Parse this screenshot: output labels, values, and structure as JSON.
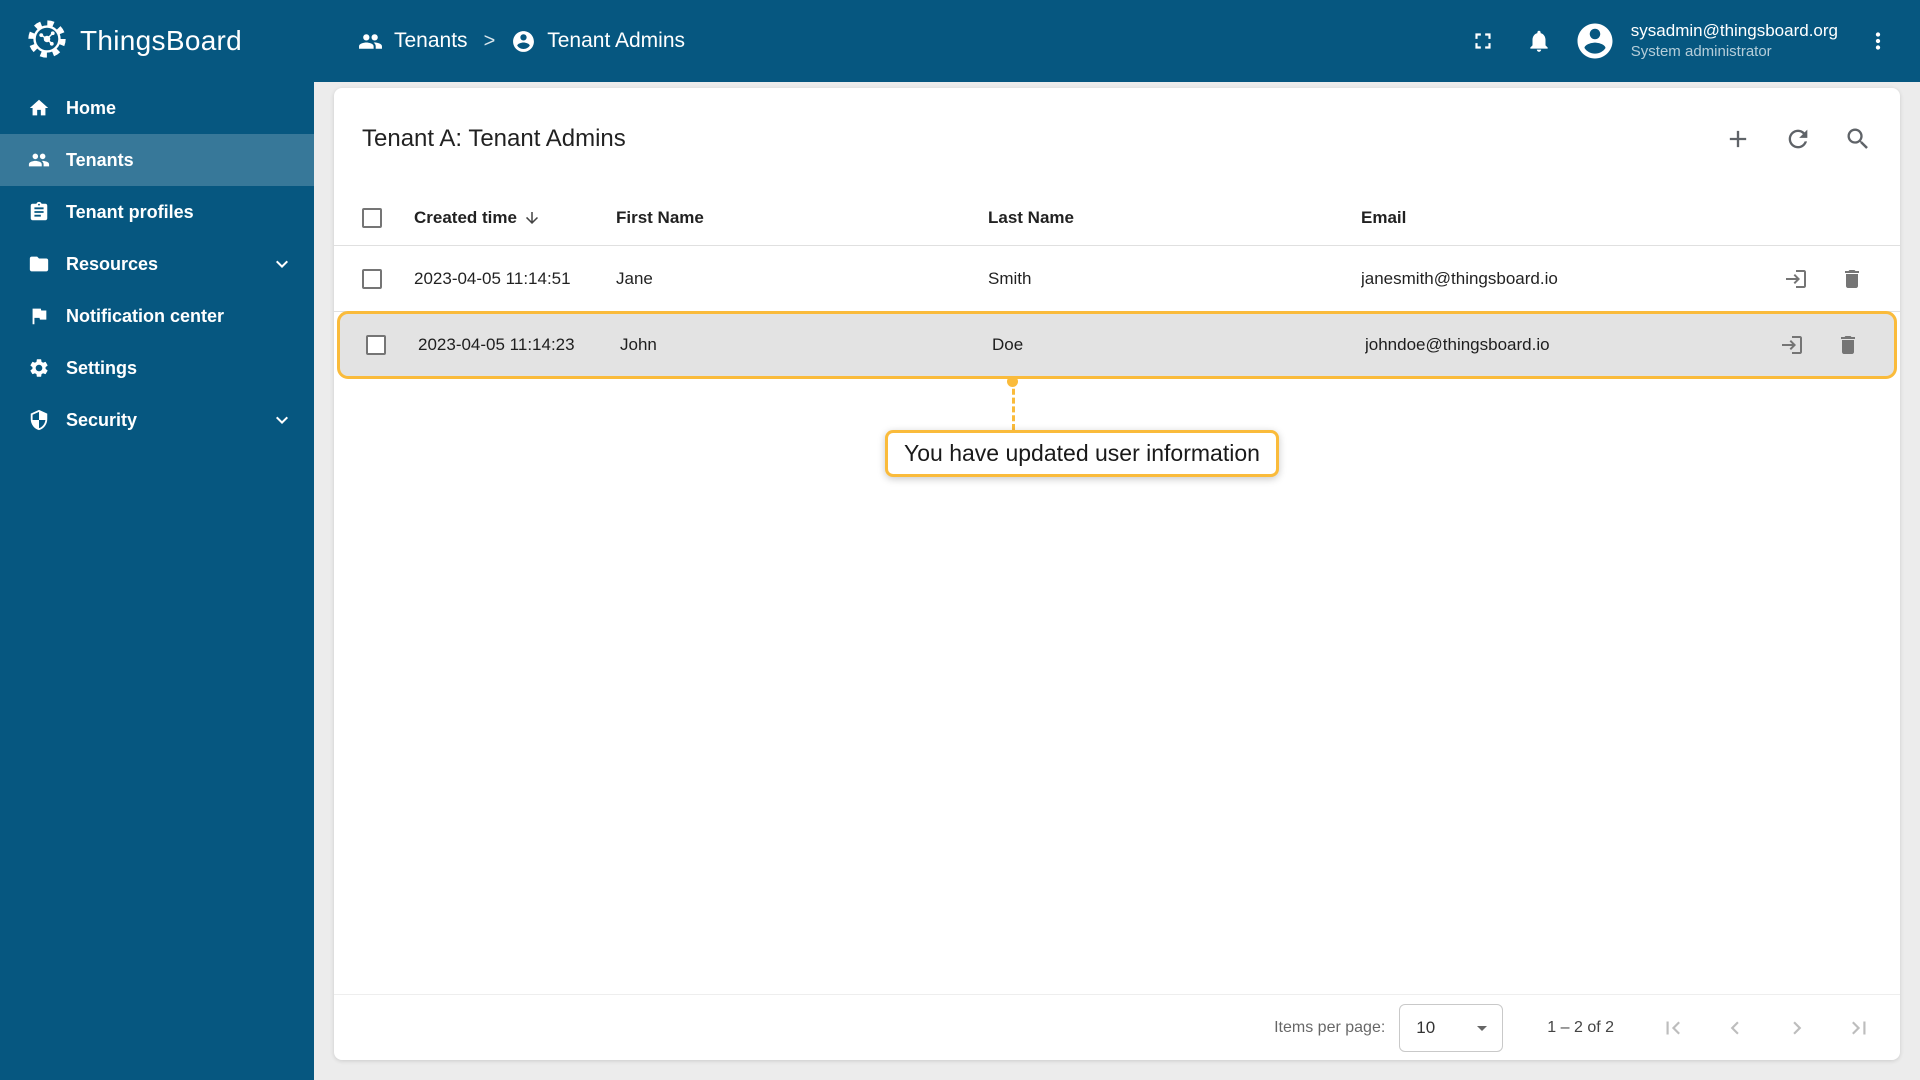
{
  "app": {
    "title": "ThingsBoard"
  },
  "header": {
    "breadcrumbs": [
      {
        "label": "Tenants"
      },
      {
        "label": "Tenant Admins"
      }
    ],
    "separator": ">",
    "user": {
      "email": "sysadmin@thingsboard.org",
      "role": "System administrator"
    }
  },
  "sidebar": {
    "items": [
      {
        "label": "Home"
      },
      {
        "label": "Tenants"
      },
      {
        "label": "Tenant profiles"
      },
      {
        "label": "Resources"
      },
      {
        "label": "Notification center"
      },
      {
        "label": "Settings"
      },
      {
        "label": "Security"
      }
    ]
  },
  "main": {
    "card_title": "Tenant A: Tenant Admins",
    "table": {
      "columns": [
        "Created time",
        "First Name",
        "Last Name",
        "Email"
      ],
      "rows": [
        {
          "created": "2023-04-05 11:14:51",
          "first": "Jane",
          "last": "Smith",
          "email": "janesmith@thingsboard.io"
        },
        {
          "created": "2023-04-05 11:14:23",
          "first": "John",
          "last": "Doe",
          "email": "johndoe@thingsboard.io"
        }
      ]
    },
    "tooltip": {
      "text": "You have updated user information"
    },
    "pagination": {
      "items_per_page_label": "Items per page:",
      "items_per_page_value": "10",
      "range": "1 – 2 of 2"
    }
  },
  "colors": {
    "primary": "#065780",
    "accent": "#FABB3B"
  }
}
